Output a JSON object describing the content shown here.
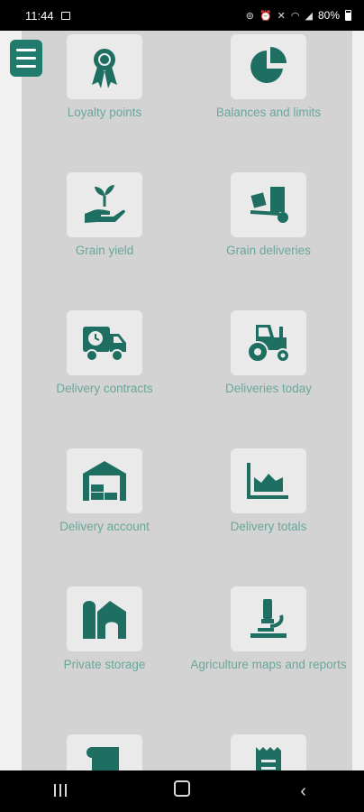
{
  "status_bar": {
    "time": "11:44",
    "battery": "80%",
    "icons": [
      "image-icon",
      "sim-icon",
      "alarm-icon",
      "mute-icon",
      "wifi-icon",
      "signal-icon",
      "battery-icon"
    ]
  },
  "menu": {
    "icon": "hamburger-menu-icon"
  },
  "tiles": [
    {
      "label": "Loyalty points",
      "icon": "ribbon-badge-icon"
    },
    {
      "label": "Balances and limits",
      "icon": "pie-chart-icon"
    },
    {
      "label": "Grain yield",
      "icon": "hand-seedling-icon"
    },
    {
      "label": "Grain deliveries",
      "icon": "box-trolley-icon"
    },
    {
      "label": "Delivery contracts",
      "icon": "truck-clock-icon"
    },
    {
      "label": "Deliveries today",
      "icon": "tractor-icon"
    },
    {
      "label": "Delivery account",
      "icon": "warehouse-icon"
    },
    {
      "label": "Delivery totals",
      "icon": "area-chart-icon"
    },
    {
      "label": "Private storage",
      "icon": "barn-silo-icon"
    },
    {
      "label": "Agriculture maps and reports",
      "icon": "microscope-icon"
    },
    {
      "label": "",
      "icon": "scroll-icon"
    },
    {
      "label": "",
      "icon": "receipt-icon"
    }
  ],
  "nav_bar": {
    "recent": "recent-apps-icon",
    "home": "home-icon",
    "back": "back-icon"
  },
  "colors": {
    "accent": "#1f6e62",
    "overlay": "#d3d3d3",
    "label": "#6aa79b",
    "tile_bg": "#eaeaea"
  }
}
